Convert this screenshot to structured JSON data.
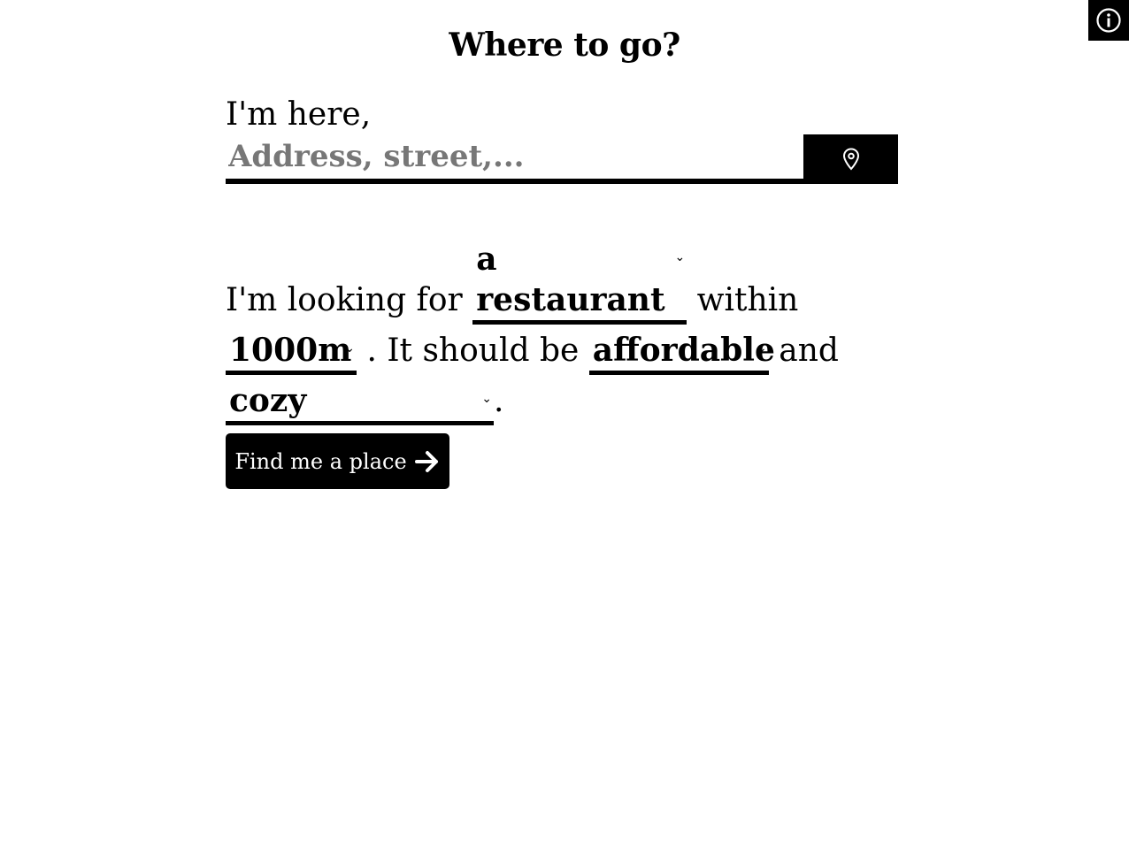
{
  "header": {
    "title": "Where to go?",
    "info_icon": "info-circle-icon"
  },
  "location": {
    "label": "I'm here,",
    "address_placeholder": "Address, street,...",
    "address_value": "",
    "locate_icon": "map-pin-icon"
  },
  "search": {
    "text_looking_for": "I'm looking for ",
    "place_type": "a restaurant",
    "text_within": " within",
    "distance": "1000m",
    "text_should_be": " . It should be ",
    "price": "affordable",
    "text_and": " and",
    "mood": "cozy",
    "text_period": "."
  },
  "action": {
    "find_label": "Find me a place",
    "find_icon": "arrow-right-icon"
  }
}
